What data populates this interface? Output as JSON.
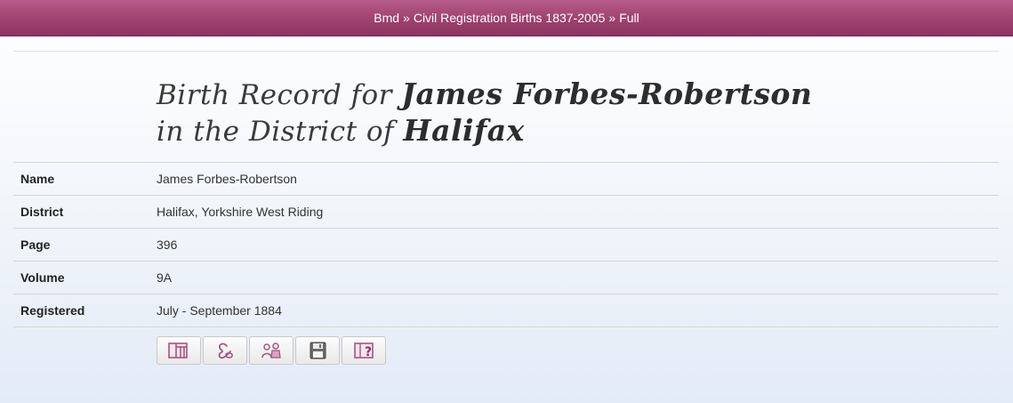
{
  "breadcrumb": {
    "items": [
      "Bmd",
      "Civil Registration Births 1837-2005",
      "Full"
    ],
    "separator": "»"
  },
  "title": {
    "line1_prefix": "Birth Record for",
    "person": "James Forbes-Robertson",
    "line2_prefix": "in the District of",
    "district": "Halifax"
  },
  "record": {
    "rows": [
      {
        "label": "Name",
        "value": "James Forbes-Robertson"
      },
      {
        "label": "District",
        "value": "Halifax, Yorkshire West Riding"
      },
      {
        "label": "Page",
        "value": "396"
      },
      {
        "label": "Volume",
        "value": "9A"
      },
      {
        "label": "Registered",
        "value": "July - September 1884"
      }
    ]
  },
  "toolbar": {
    "buttons": [
      {
        "icon": "register-book-icon"
      },
      {
        "icon": "ampersand-link-icon"
      },
      {
        "icon": "people-pair-icon"
      },
      {
        "icon": "save-disk-icon"
      },
      {
        "icon": "help-question-icon"
      }
    ]
  },
  "colors": {
    "header_bar": "#a0436f",
    "icon_accent": "#a8547f"
  }
}
